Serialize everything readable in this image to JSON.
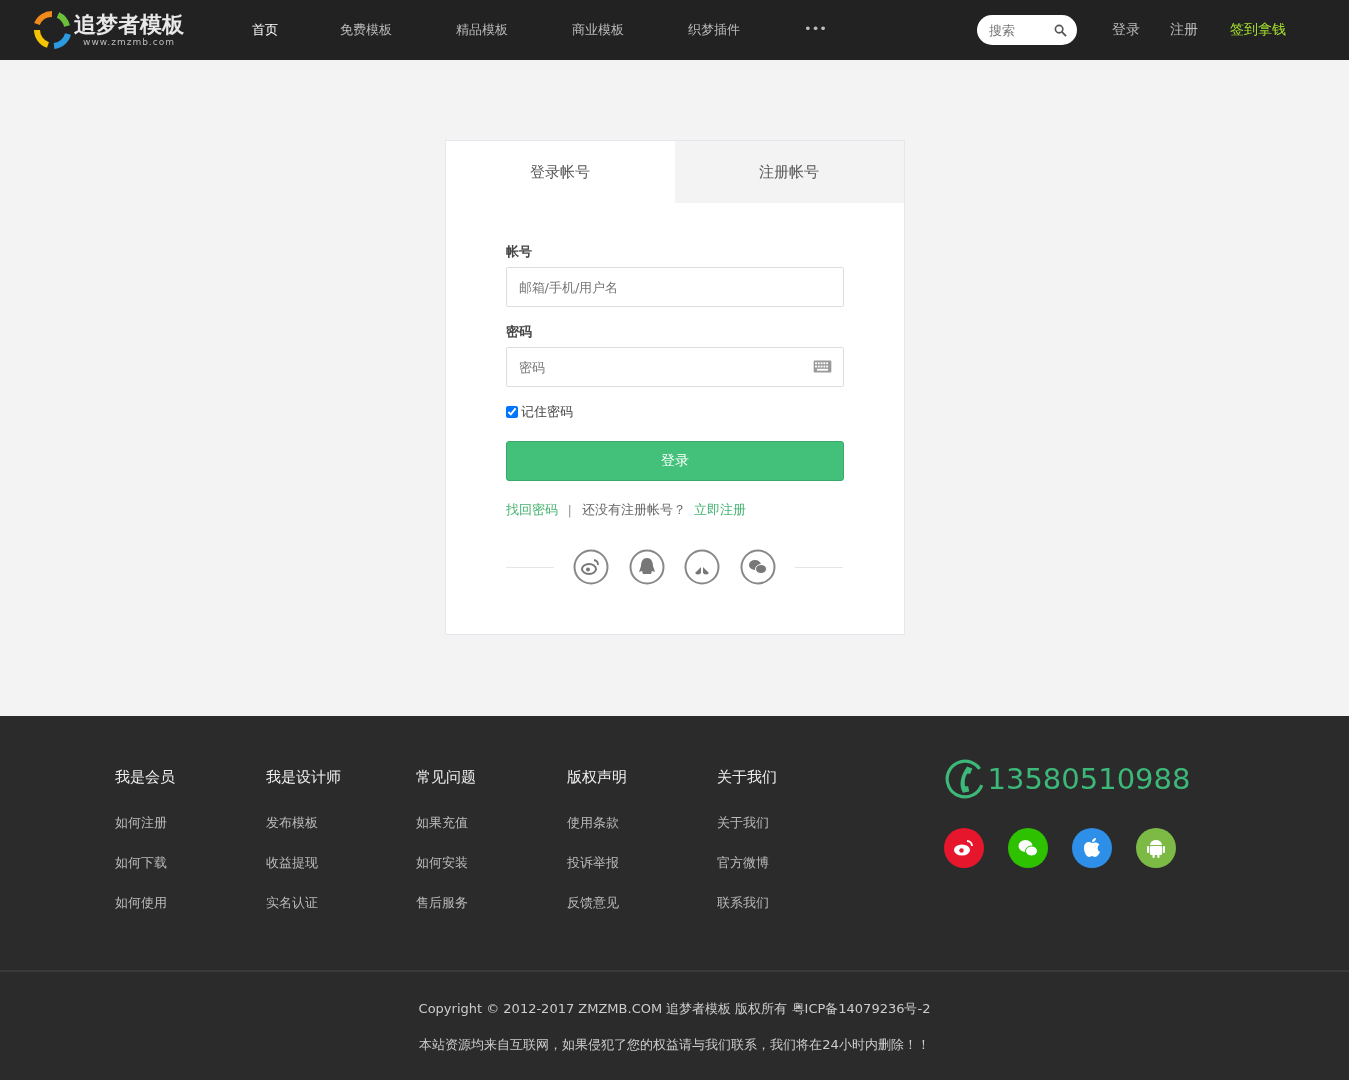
{
  "header": {
    "logo_text": "追梦者模板",
    "logo_url": "www.zmzmb.com",
    "nav": [
      {
        "label": "首页",
        "selected": true
      },
      {
        "label": "免费模板",
        "selected": false
      },
      {
        "label": "精品模板",
        "selected": false
      },
      {
        "label": "商业模板",
        "selected": false
      },
      {
        "label": "织梦插件",
        "selected": false
      },
      {
        "label": "•••",
        "selected": false
      }
    ],
    "search": {
      "placeholder": "搜索"
    },
    "links": [
      {
        "label": "登录",
        "kind": "plain"
      },
      {
        "label": "注册",
        "kind": "plain"
      },
      {
        "label": "签到拿钱",
        "kind": "highlight"
      }
    ]
  },
  "login_card": {
    "tabs": [
      {
        "label": "登录帐号",
        "selected": true
      },
      {
        "label": "注册帐号",
        "selected": false
      }
    ],
    "fields": [
      {
        "label": "帐号",
        "placeholder": "邮箱/手机/用户名",
        "kind": "text"
      },
      {
        "label": "密码",
        "placeholder": "密码",
        "kind": "password"
      }
    ],
    "remember": {
      "label": "记住密码",
      "checked": true
    },
    "submit": "登录",
    "forgot_link": "找回密码",
    "separator": "|",
    "no_account_text": "还没有注册帐号？",
    "register_link": "立即注册",
    "social_logins": [
      {
        "kind": "weibo"
      },
      {
        "kind": "qq"
      },
      {
        "kind": "baidu"
      },
      {
        "kind": "wechat"
      }
    ]
  },
  "footer": {
    "columns": [
      {
        "title": "我是会员",
        "links": [
          "如何注册",
          "如何下载",
          "如何使用"
        ]
      },
      {
        "title": "我是设计师",
        "links": [
          "发布模板",
          "收益提现",
          "实名认证"
        ]
      },
      {
        "title": "常见问题",
        "links": [
          "如果充值",
          "如何安装",
          "售后服务"
        ]
      },
      {
        "title": "版权声明",
        "links": [
          "使用条款",
          "投诉举报",
          "反馈意见"
        ]
      },
      {
        "title": "关于我们",
        "links": [
          "关于我们",
          "官方微博",
          "联系我们"
        ]
      }
    ],
    "phone": "13580510988",
    "apps": [
      {
        "kind": "weibo",
        "color": "#e6162d"
      },
      {
        "kind": "wechat",
        "color": "#2dc100"
      },
      {
        "kind": "apple",
        "color": "#2e8fe8"
      },
      {
        "kind": "android",
        "color": "#7cba45"
      }
    ],
    "copyright": "Copyright © 2012-2017 ZMZMB.COM 追梦者模板 版权所有 粤ICP备14079236号-2",
    "disclaimer": "本站资源均来自互联网，如果侵犯了您的权益请与我们联系，我们将在24小时内删除！！"
  }
}
